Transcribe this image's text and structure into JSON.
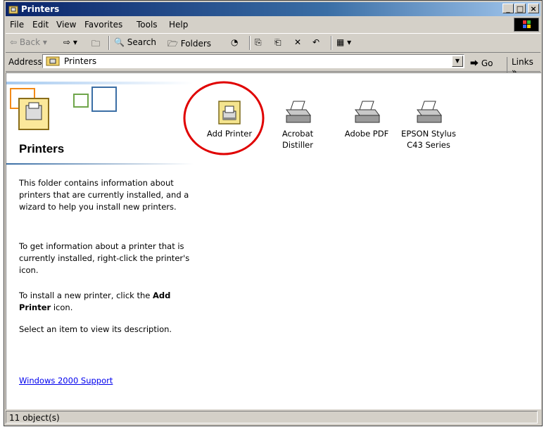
{
  "window": {
    "title": "Printers",
    "controls": {
      "minimize": "_",
      "maximize": "□",
      "close": "×"
    }
  },
  "menu": [
    {
      "label": "File"
    },
    {
      "label": "Edit"
    },
    {
      "label": "View"
    },
    {
      "label": "Favorites"
    },
    {
      "label": "Tools"
    },
    {
      "label": "Help"
    }
  ],
  "toolbar": {
    "back": "Back",
    "search": "Search",
    "folders": "Folders"
  },
  "address": {
    "label": "Address",
    "value": "Printers",
    "go": "Go",
    "links": "Links »"
  },
  "left_pane": {
    "title": "Printers",
    "paragraphs": [
      "This folder contains information about printers that are currently installed, and a wizard to help you install new printers.",
      "To get information about a printer that is currently installed, right-click the printer's icon."
    ],
    "install_text_before": "To install a new printer, click the ",
    "install_bold": "Add Printer",
    "install_text_after": " icon.",
    "select_text": "Select an item to view its description.",
    "support_link": "Windows 2000 Support"
  },
  "printers": [
    {
      "line1": "Add Printer",
      "line2": "",
      "icon": "add-printer-icon"
    },
    {
      "line1": "Acrobat",
      "line2": "Distiller",
      "icon": "printer-icon"
    },
    {
      "line1": "Adobe PDF",
      "line2": "",
      "icon": "printer-icon"
    },
    {
      "line1": "EPSON Stylus",
      "line2": "C43 Series",
      "icon": "printer-icon"
    }
  ],
  "status": {
    "objects": "11 object(s)"
  },
  "colors": {
    "title_bar": "#0a246a",
    "highlight_circle": "#e00000",
    "link": "#0000ee"
  }
}
